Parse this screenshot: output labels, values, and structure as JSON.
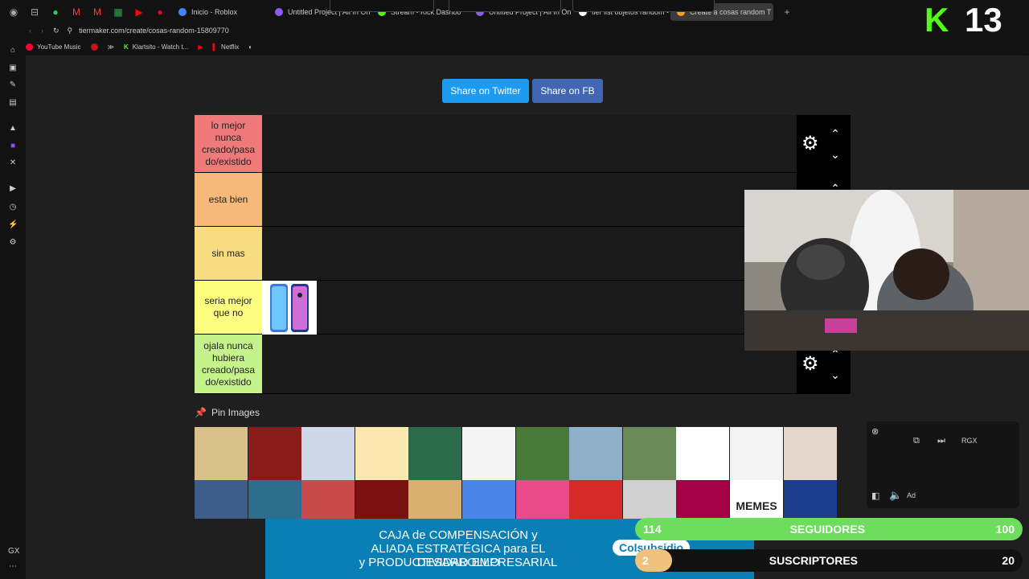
{
  "browser": {
    "tabs": [
      {
        "label": "Inicio - Roblox",
        "color": "#4285f4",
        "active": false
      },
      {
        "label": "Untitled Project | All In On",
        "color": "#8b5cf6",
        "active": false
      },
      {
        "label": "Stream - Kick Dashbo",
        "color": "#53fc18",
        "active": false
      },
      {
        "label": "Untitled Project | All In On",
        "color": "#8b5cf6",
        "active": false
      },
      {
        "label": "tier list objetos random -",
        "color": "#ffffff",
        "active": false
      },
      {
        "label": "Create a cosas random T",
        "color": "#ff9f1c",
        "active": true
      }
    ],
    "url": "tiermaker.com/create/cosas-random-15809770",
    "bookmarks": [
      "YouTube Music",
      "Klartsito - Watch t...",
      "Netflix"
    ]
  },
  "page": {
    "share_twitter": "Share on Twitter",
    "share_fb": "Share on FB",
    "tiers": [
      {
        "label": "lo mejor nunca creado/pasa do/existido",
        "color": "#f07a7a"
      },
      {
        "label": "esta bien",
        "color": "#f6b97a"
      },
      {
        "label": "sin mas",
        "color": "#f8dd80"
      },
      {
        "label": "seria mejor que no",
        "color": "#fdfe80"
      },
      {
        "label": "ojala nunca hubiera creado/pasa do/existido",
        "color": "#c5f28a"
      }
    ],
    "pin_images_label": "Pin Images",
    "thumb_memes_label": "MEMES"
  },
  "overlay": {
    "k13_left": "K",
    "k13_right": "13",
    "seguidores_count": "114",
    "seguidores_label": "SEGUIDORES",
    "seguidores_goal": "100",
    "suscriptores_count": "2",
    "suscriptores_label": "SUSCRIPTORES",
    "suscriptores_goal": "20"
  },
  "ad": {
    "line1": "CAJA de COMPENSACIÓN y",
    "line2": "ALIADA ESTRATÉGICA para EL DESARROLLO",
    "line3": "y PRODUCTIVIDAD EMPRESARIAL",
    "brand": "Colsubsidio"
  },
  "miniplayer": {
    "label": "RGX",
    "ad_tag": "Ad"
  }
}
